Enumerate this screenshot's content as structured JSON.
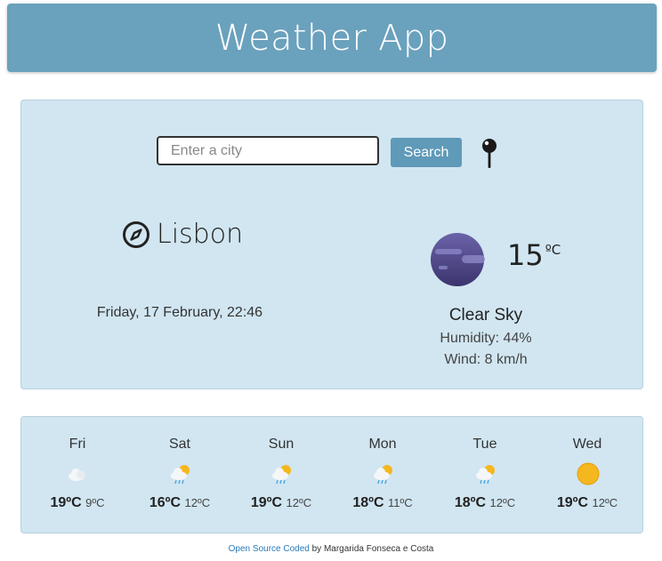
{
  "header": {
    "title": "Weather App"
  },
  "search": {
    "placeholder": "Enter a city",
    "button_label": "Search"
  },
  "current": {
    "city": "Lisbon",
    "date": "Friday, 17 February, 22:46",
    "temperature": "15",
    "unit": "ºC",
    "description": "Clear Sky",
    "humidity": "Humidity: 44%",
    "wind": "Wind: 8 km/h"
  },
  "forecast": [
    {
      "day": "Fri",
      "max": "19ºC",
      "min": "9ºC",
      "icon": "cloud-icon"
    },
    {
      "day": "Sat",
      "max": "16ºC",
      "min": "12ºC",
      "icon": "sun-rain-cloud-icon"
    },
    {
      "day": "Sun",
      "max": "19ºC",
      "min": "12ºC",
      "icon": "sun-rain-cloud-icon"
    },
    {
      "day": "Mon",
      "max": "18ºC",
      "min": "11ºC",
      "icon": "sun-rain-cloud-icon"
    },
    {
      "day": "Tue",
      "max": "18ºC",
      "min": "12ºC",
      "icon": "sun-rain-cloud-icon"
    },
    {
      "day": "Wed",
      "max": "19ºC",
      "min": "12ºC",
      "icon": "sun-icon"
    }
  ],
  "footer": {
    "link": "Open Source Coded",
    "text": " by Margarida Fonseca e Costa"
  },
  "colors": {
    "header_bg": "#6aa1bd",
    "panel_bg": "#d1e6f1",
    "button_bg": "#5f9ab8",
    "link": "#2a7ab8"
  }
}
